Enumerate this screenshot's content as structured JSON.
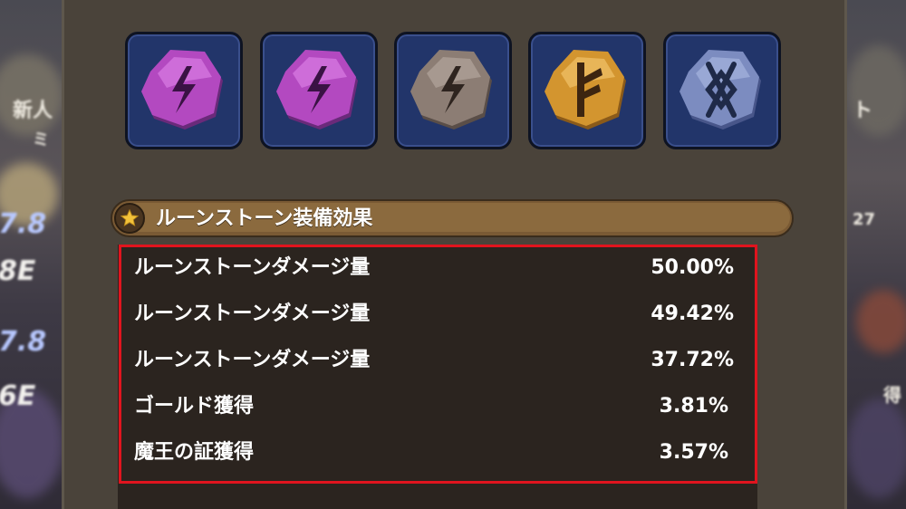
{
  "runes": [
    {
      "name": "purple-lightning-rune",
      "color": "#b349c0",
      "glyph": "lightning"
    },
    {
      "name": "purple-lightning-rune",
      "color": "#b349c0",
      "glyph": "lightning"
    },
    {
      "name": "gray-lightning-rune",
      "color": "#8c7d74",
      "glyph": "lightning"
    },
    {
      "name": "gold-f-rune",
      "color": "#d3952f",
      "glyph": "f"
    },
    {
      "name": "blue-diamond-rune",
      "color": "#7c8cc0",
      "glyph": "diamond"
    }
  ],
  "section": {
    "title": "ルーンストーン装備効果",
    "icon": "star-icon"
  },
  "effects": [
    {
      "label": "ルーンストーンダメージ量",
      "value": "50.00%"
    },
    {
      "label": "ルーンストーンダメージ量",
      "value": "49.42%"
    },
    {
      "label": "ルーンストーンダメージ量",
      "value": "37.72%"
    },
    {
      "label": "ゴールド獲得",
      "value": "3.81%"
    },
    {
      "label": "魔王の証獲得",
      "value": "3.57%"
    }
  ],
  "background": {
    "left_texts": [
      "新人",
      "ミ",
      "7.8",
      "8E",
      "7.8",
      "6E"
    ],
    "right_texts": [
      "ト",
      "27",
      "得"
    ]
  },
  "colors": {
    "highlight_border": "#e0141e",
    "slot_bg": "#22356a",
    "header_bg": "#8b6a3e"
  }
}
